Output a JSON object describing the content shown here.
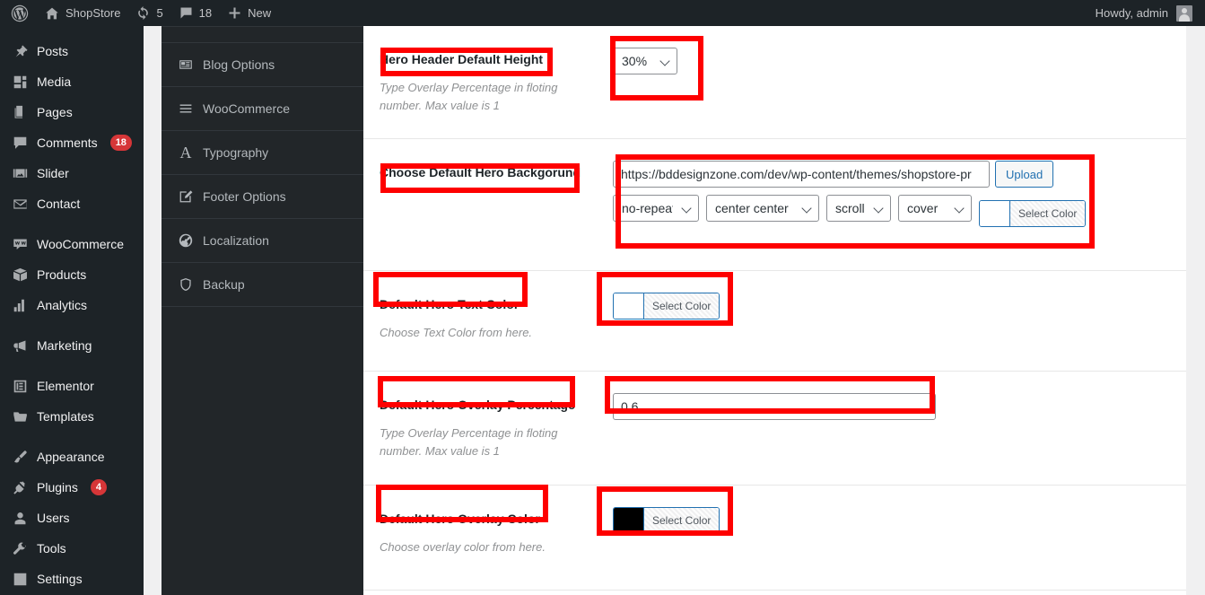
{
  "adminbar": {
    "logo_icon": "wordpress-icon",
    "site_icon": "home-icon",
    "site_name": "ShopStore",
    "updates_icon": "updates-icon",
    "updates_count": "5",
    "comments_icon": "comment-bubble-icon",
    "comments_count": "18",
    "new_icon": "plus-icon",
    "new_label": "New",
    "howdy": "Howdy, admin",
    "avatar_icon": "avatar-icon"
  },
  "sidebar": {
    "items": [
      {
        "label": "Posts",
        "icon": "pin-icon",
        "badge": null
      },
      {
        "label": "Media",
        "icon": "media-icon",
        "badge": null
      },
      {
        "label": "Pages",
        "icon": "pages-icon",
        "badge": null
      },
      {
        "label": "Comments",
        "icon": "comment-icon",
        "badge": "18"
      },
      {
        "label": "Slider",
        "icon": "slider-icon",
        "badge": null
      },
      {
        "label": "Contact",
        "icon": "envelope-icon",
        "badge": null
      },
      {
        "label": "WooCommerce",
        "icon": "woo-icon",
        "badge": null
      },
      {
        "label": "Products",
        "icon": "box-icon",
        "badge": null
      },
      {
        "label": "Analytics",
        "icon": "bar-chart-icon",
        "badge": null
      },
      {
        "label": "Marketing",
        "icon": "megaphone-icon",
        "badge": null
      },
      {
        "label": "Elementor",
        "icon": "elementor-icon",
        "badge": null
      },
      {
        "label": "Templates",
        "icon": "folder-icon",
        "badge": null
      },
      {
        "label": "Appearance",
        "icon": "paintbrush-icon",
        "badge": null
      },
      {
        "label": "Plugins",
        "icon": "plug-icon",
        "badge": "4"
      },
      {
        "label": "Users",
        "icon": "user-icon",
        "badge": null
      },
      {
        "label": "Tools",
        "icon": "wrench-icon",
        "badge": null
      },
      {
        "label": "Settings",
        "icon": "sliders-icon",
        "badge": null
      }
    ]
  },
  "optionnav": {
    "items": [
      {
        "label": "Blog Options",
        "icon": "newspaper-icon"
      },
      {
        "label": "WooCommerce",
        "icon": "hamburger-icon"
      },
      {
        "label": "Typography",
        "icon": "letter-a-icon"
      },
      {
        "label": "Footer Options",
        "icon": "pencil-square-icon"
      },
      {
        "label": "Localization",
        "icon": "globe-icon"
      },
      {
        "label": "Backup",
        "icon": "shield-icon"
      }
    ]
  },
  "form": {
    "rows": [
      {
        "label": "Hero Header Default Height",
        "desc": "Type Overlay Percentage in floting number. Max value is 1",
        "select_value": "30%"
      },
      {
        "label": "Choose Default Hero Backgorund",
        "desc": "",
        "url_value": "https://bddesignzone.com/dev/wp-content/themes/shopstore-pr",
        "upload_label": "Upload",
        "repeat_value": "no-repeat",
        "position_value": "center center",
        "attachment_value": "scroll",
        "size_value": "cover",
        "color_label": "Select Color",
        "color_swatch": "#ffffff"
      },
      {
        "label": "Default Hero Text Color",
        "desc": "Choose Text Color from here.",
        "color_label": "Select Color",
        "color_swatch": "#ffffff"
      },
      {
        "label": "Default Hero Overlay Percentage",
        "desc": "Type Overlay Percentage in floting number. Max value is 1",
        "number_value": "0.6"
      },
      {
        "label": "Default Hero Overlay Color",
        "desc": "Choose overlay color from here.",
        "color_label": "Select Color",
        "color_swatch": "#000000"
      }
    ]
  },
  "annotation": {
    "color": "#fe0000"
  }
}
